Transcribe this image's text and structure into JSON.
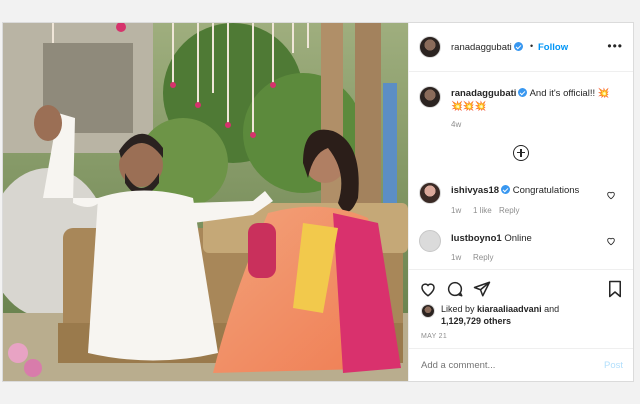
{
  "post": {
    "author": "ranadaggubati",
    "follow_label": "Follow",
    "separator": "•",
    "more_label": "•••",
    "image_alt": "Couple seated on a wicker sofa outdoors under floral garlands"
  },
  "caption": {
    "username": "ranadaggubati",
    "text": "And it's official!! 💥",
    "text_line2": "💥💥💥",
    "age": "4w"
  },
  "comments": [
    {
      "username": "ishivyas18",
      "text": "Congratulations",
      "age": "1w",
      "likes": "1 like",
      "reply": "Reply"
    },
    {
      "username": "lustboyno1",
      "text": "Online",
      "age": "1w",
      "reply": "Reply"
    }
  ],
  "likes": {
    "prefix": "Liked by",
    "user": "kiaraaliaadvani",
    "joiner": "and",
    "count": "1,129,729 others"
  },
  "date": "MAY 21",
  "comment_box": {
    "placeholder": "Add a comment...",
    "post_label": "Post"
  },
  "colors": {
    "accent": "#0095f6",
    "verified": "#3897f0",
    "muted": "#8e8e8e"
  }
}
